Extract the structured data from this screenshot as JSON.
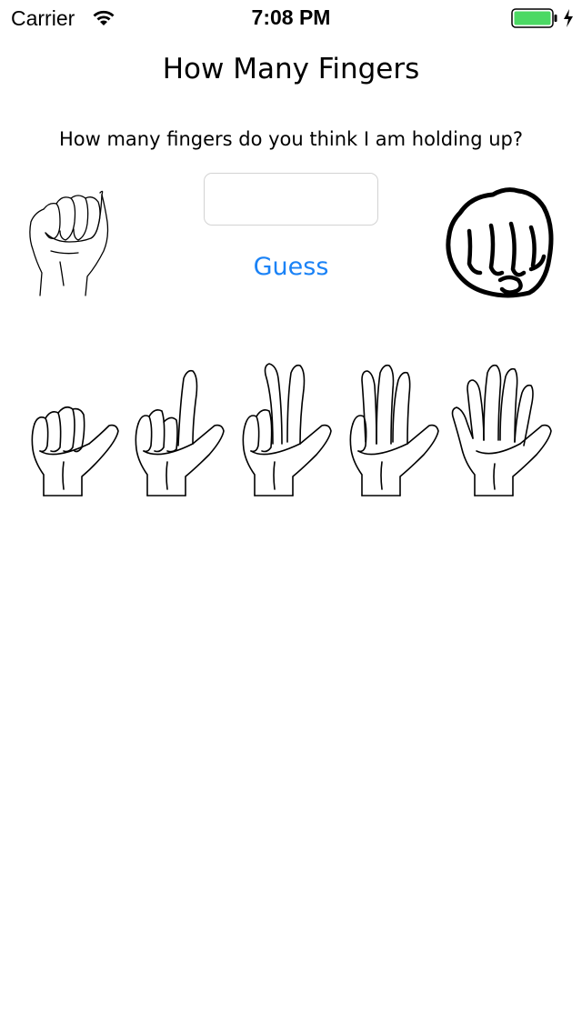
{
  "status_bar": {
    "carrier": "Carrier",
    "time": "7:08 PM",
    "battery_color": "#4cd964"
  },
  "title": "How Many Fingers",
  "prompt": "How many fingers do you think I am holding up?",
  "guess_input": {
    "value": "",
    "placeholder": ""
  },
  "guess_button_label": "Guess",
  "accent_color": "#1a82f6",
  "hands": [
    {
      "name": "zero-fingers",
      "count": 0
    },
    {
      "name": "one-finger",
      "count": 1
    },
    {
      "name": "two-fingers",
      "count": 2
    },
    {
      "name": "three-fingers",
      "count": 3
    },
    {
      "name": "four-fingers",
      "count": 4
    },
    {
      "name": "five-fingers",
      "count": 5
    }
  ]
}
